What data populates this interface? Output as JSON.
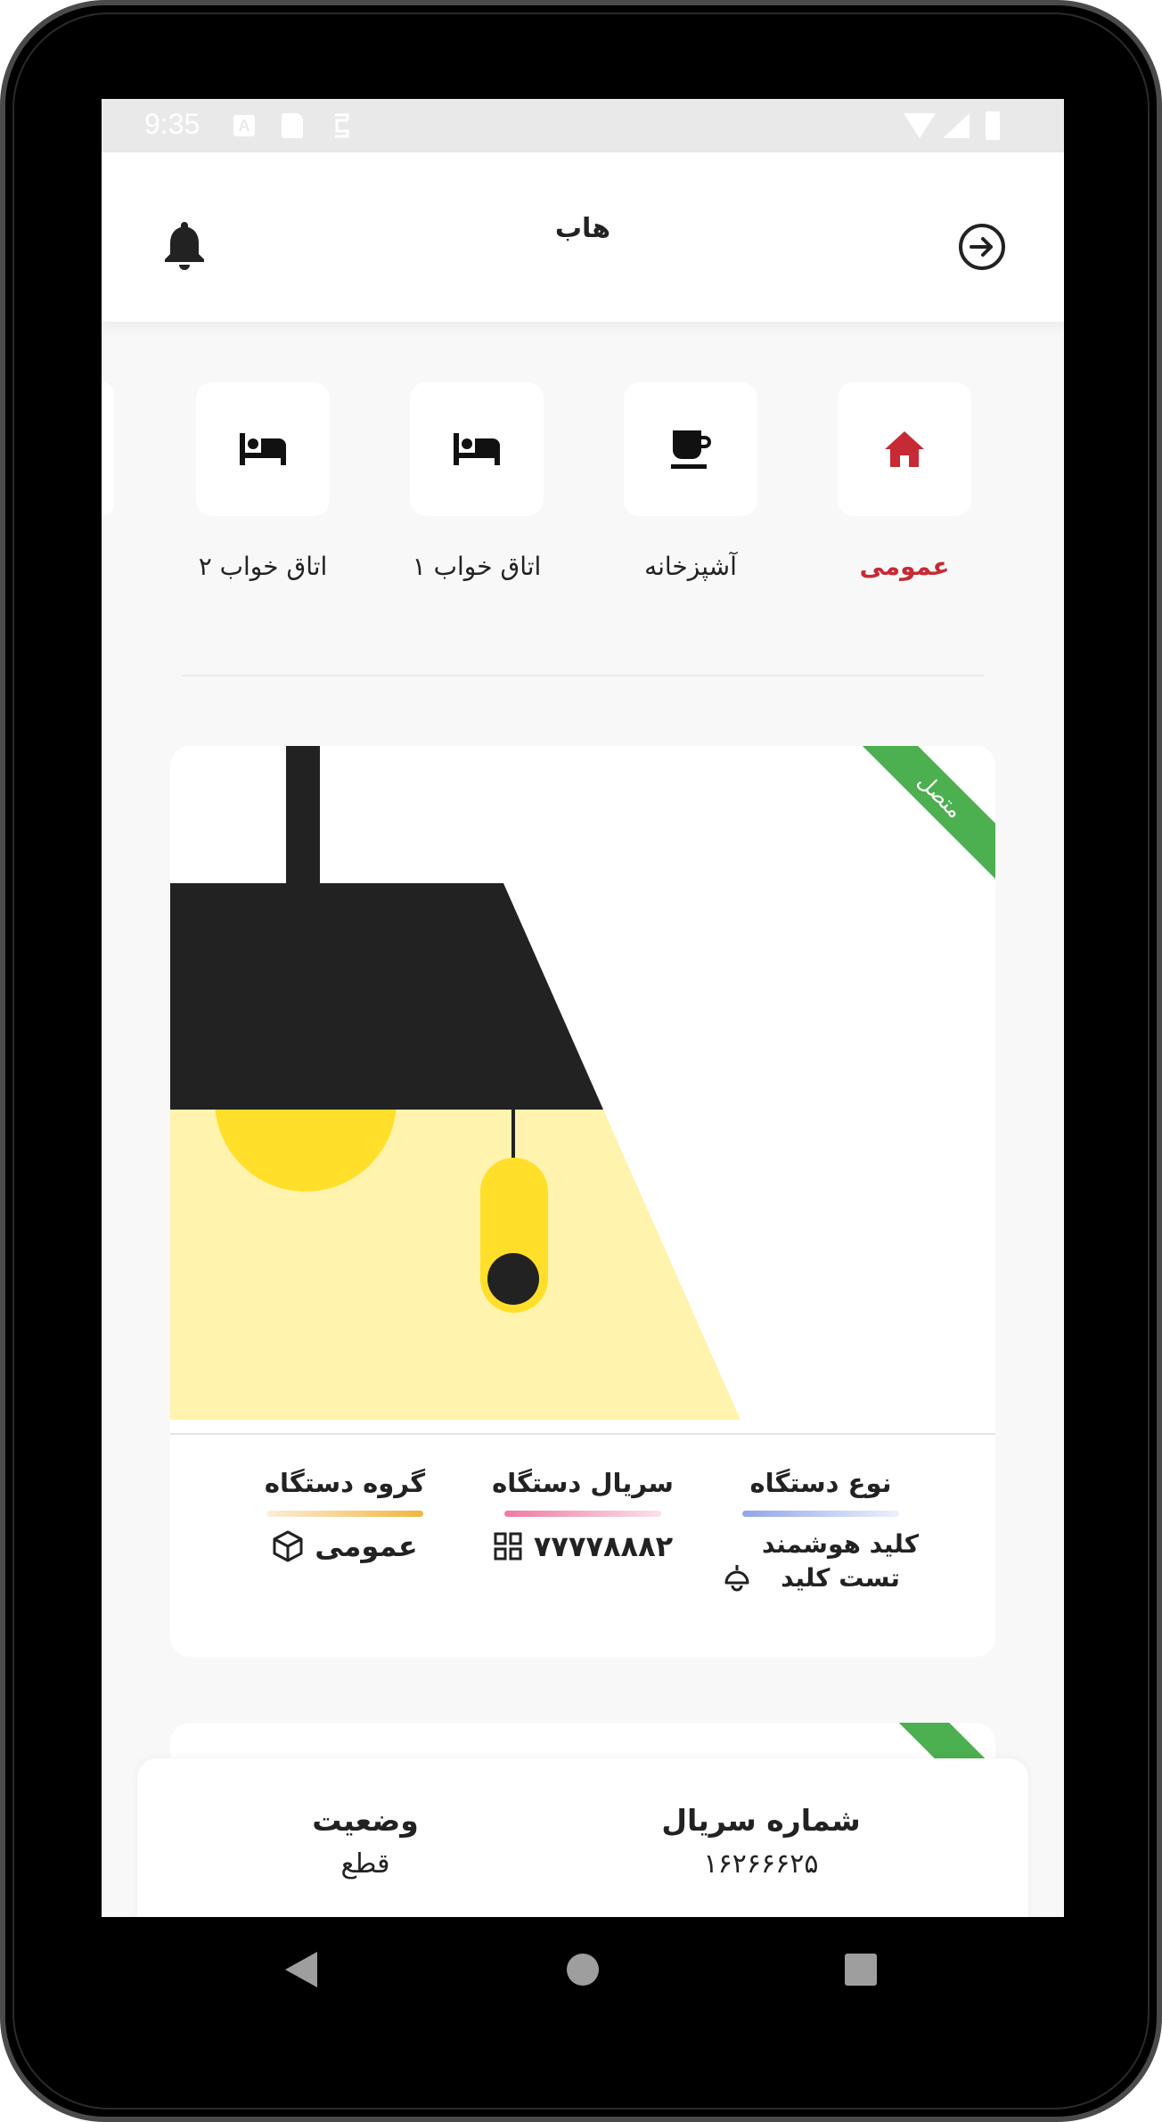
{
  "status_bar": {
    "time": "9:35",
    "a_icon": "A"
  },
  "app_bar": {
    "title": "هاب"
  },
  "categories": [
    {
      "label": "عمومی",
      "icon": "home-icon",
      "active": true
    },
    {
      "label": "آشپزخانه",
      "icon": "coffee-cup-icon",
      "active": false
    },
    {
      "label": "اتاق خواب ۱",
      "icon": "bed-icon",
      "active": false
    },
    {
      "label": "اتاق خواب ۲",
      "icon": "bed-icon",
      "active": false
    }
  ],
  "device_card": {
    "badge": "متصل",
    "type_title": "نوع دستگاه",
    "type_value_line1": "کلید هوشمند",
    "type_value_line2": "تست کلید",
    "serial_title": "سریال دستگاه",
    "serial_value": "۷۷۷۷۸۸۸۲",
    "group_title": "گروه دستگاه",
    "group_value": "عمومی"
  },
  "bottom_panel": {
    "serial_title": "شماره سریال",
    "serial_value": "۱۶۲۶۶۶۲۵",
    "status_title": "وضعیت",
    "status_value": "قطع"
  },
  "colors": {
    "accent_red": "#c62a35",
    "connected_green": "#4caf50",
    "lamp_dark": "#222222",
    "lamp_yellow": "#ffdf2a",
    "light_beam": "#fff3ad"
  }
}
